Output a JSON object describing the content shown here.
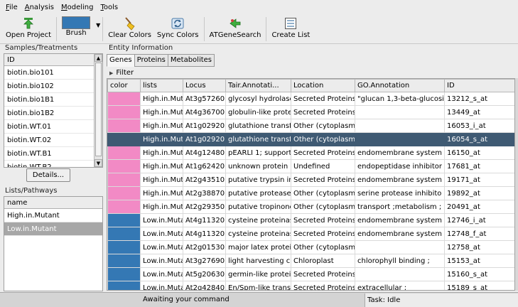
{
  "menu": [
    "File",
    "Analysis",
    "Modeling",
    "Tools"
  ],
  "toolbar": {
    "open_project": "Open Project",
    "brush": "Brush",
    "brush_color": "#3478b4",
    "clear_colors": "Clear Colors",
    "sync_colors": "Sync Colors",
    "atgenesearch": "ATGeneSearch",
    "create_list": "Create List"
  },
  "samples": {
    "group_label": "Samples/Treatments",
    "header": "ID",
    "items": [
      "biotin.bio101",
      "biotin.bio102",
      "biotin.bio1B1",
      "biotin.bio1B2",
      "biotin.WT.01",
      "biotin.WT.02",
      "biotin.WT.B1",
      "biotin.WT.B2"
    ]
  },
  "details_button": "Details...",
  "lists": {
    "group_label": "Lists/Pathways",
    "header": "name",
    "items": [
      "High.in.Mutant",
      "Low.in.Mutant"
    ],
    "selected_index": 1
  },
  "entity": {
    "group_label": "Entity Information",
    "tabs": [
      "Genes",
      "Proteins",
      "Metabolites"
    ],
    "active_tab": 0,
    "filter_label": "Filter",
    "columns": [
      "color",
      "lists",
      "Locus",
      "Tair.Annotati...",
      "Location",
      "GO.Annotation",
      "ID"
    ],
    "colors": {
      "pink": "#f28ac5",
      "blue": "#3478b4",
      "selected": "#3f5a73"
    },
    "rows": [
      {
        "color": "pink",
        "lists": "High.in.Muta",
        "locus": "At3g57260",
        "tair": "glycosyl hydrolase",
        "location": "Secreted Proteins",
        "go": "\"glucan 1,3-beta-glucosi",
        "id": "13212_s_at"
      },
      {
        "color": "pink",
        "lists": "High.in.Muta",
        "locus": "At4g36700",
        "tair": "globulin-like protei",
        "location": "Secreted Proteins",
        "go": "",
        "id": "13449_at"
      },
      {
        "color": "pink",
        "lists": "High.in.Muta",
        "locus": "At1g02920",
        "tair": "glutathione transfe",
        "location": "Other (cytoplasm",
        "go": "",
        "id": "16053_i_at"
      },
      {
        "color": "pink",
        "lists": "High.in.Muta",
        "locus": "At1g02920",
        "tair": "glutathione transfe",
        "location": "Other (cytoplasm",
        "go": "",
        "id": "16054_s_at",
        "selected": true
      },
      {
        "color": "pink",
        "lists": "High.in.Muta",
        "locus": "At4g12480",
        "tair": "pEARLI 1; support",
        "location": "Secreted Proteins",
        "go": "endomembrane system",
        "id": "16150_at"
      },
      {
        "color": "pink",
        "lists": "High.in.Muta",
        "locus": "At1g62420",
        "tair": "unknown protein",
        "location": "Undefined",
        "go": "endopeptidase inhibitor",
        "id": "17681_at"
      },
      {
        "color": "pink",
        "lists": "High.in.Muta",
        "locus": "At2g43510",
        "tair": "putative trypsin in",
        "location": "Secreted Proteins",
        "go": "endomembrane system",
        "id": "19171_at"
      },
      {
        "color": "pink",
        "lists": "High.in.Muta",
        "locus": "At2g38870",
        "tair": "putative protease",
        "location": "Other (cytoplasm",
        "go": "serine protease inhibito",
        "id": "19892_at"
      },
      {
        "color": "pink",
        "lists": "High.in.Muta",
        "locus": "At2g29350",
        "tair": "putative tropinone",
        "location": "Other (cytoplasm",
        "go": "transport ;metabolism ;",
        "id": "20491_at"
      },
      {
        "color": "blue",
        "lists": "Low.in.Muta",
        "locus": "At4g11320",
        "tair": "cysteine proteinas",
        "location": "Secreted Proteins",
        "go": "endomembrane system",
        "id": "12746_i_at"
      },
      {
        "color": "blue",
        "lists": "Low.in.Muta",
        "locus": "At4g11320",
        "tair": "cysteine proteinas",
        "location": "Secreted Proteins",
        "go": "endomembrane system",
        "id": "12748_f_at"
      },
      {
        "color": "blue",
        "lists": "Low.in.Muta",
        "locus": "At2g01530",
        "tair": "major latex protei",
        "location": "Other (cytoplasm",
        "go": "",
        "id": "12758_at"
      },
      {
        "color": "blue",
        "lists": "Low.in.Muta",
        "locus": "At3g27690",
        "tair": "light harvesting ch",
        "location": "Chloroplast",
        "go": "chlorophyll binding ;",
        "id": "15153_at"
      },
      {
        "color": "blue",
        "lists": "Low.in.Muta",
        "locus": "At5g20630",
        "tair": "germin-like protei",
        "location": "Secreted Proteins",
        "go": "",
        "id": "15160_s_at"
      },
      {
        "color": "blue",
        "lists": "Low.in.Muta",
        "locus": "At2g42840",
        "tair": "En/Spm-like transp",
        "location": "Secreted Proteins",
        "go": "extracellular ;",
        "id": "15189_s_at"
      }
    ]
  },
  "status": {
    "message": "Awaiting your command",
    "task": "Task: Idle"
  }
}
